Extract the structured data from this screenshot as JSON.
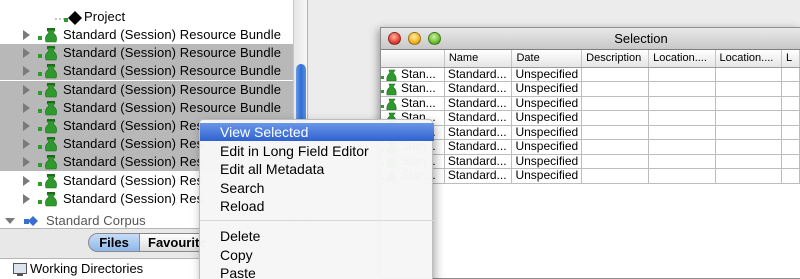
{
  "tree": {
    "project_label": "Project",
    "rows": [
      {
        "label": "Standard (Session) Resource Bundle",
        "selected": false
      },
      {
        "label": "Standard (Session) Resource Bundle",
        "selected": true
      },
      {
        "label": "Standard (Session) Resource Bundle",
        "selected": true
      },
      {
        "label": "Standard (Session) Resource Bundle",
        "selected": true
      },
      {
        "label": "Standard (Session) Resource Bundle",
        "selected": true
      },
      {
        "label": "Standard (Session) Res",
        "selected": true
      },
      {
        "label": "Standard (Session) Res",
        "selected": true
      },
      {
        "label": "Standard (Session) Res",
        "selected": true
      },
      {
        "label": "Standard (Session) Res",
        "selected": false
      },
      {
        "label": "Standard (Session) Res",
        "selected": false
      }
    ],
    "partial_label": "Standard Corpus"
  },
  "tabs": {
    "files": "Files",
    "favourites": "Favourite"
  },
  "working_directories": "Working Directories",
  "selection_window": {
    "title": "Selection",
    "columns": [
      "",
      "Name",
      "Date",
      "Description",
      "Location....",
      "Location....",
      "L"
    ],
    "rows": [
      {
        "type": "Stan...",
        "name": "Standard...",
        "date": "Unspecified"
      },
      {
        "type": "Stan...",
        "name": "Standard...",
        "date": "Unspecified"
      },
      {
        "type": "Stan...",
        "name": "Standard...",
        "date": "Unspecified"
      },
      {
        "type": "Stan...",
        "name": "Standard...",
        "date": "Unspecified"
      },
      {
        "type": "Stan...",
        "name": "Standard...",
        "date": "Unspecified"
      },
      {
        "type": "Stan...",
        "name": "Standard...",
        "date": "Unspecified"
      },
      {
        "type": "Stan...",
        "name": "Standard...",
        "date": "Unspecified"
      },
      {
        "type": "Stan...",
        "name": "Standard...",
        "date": "Unspecified"
      }
    ]
  },
  "context_menu": {
    "group1": [
      "View Selected",
      "Edit in Long Field Editor",
      "Edit all Metadata",
      "Search",
      "Reload"
    ],
    "group2": [
      "Delete",
      "Copy",
      "Paste"
    ]
  },
  "colors": {
    "selection_highlight": "#b8b8b8",
    "menu_active": "#2f62d0",
    "scroll_thumb": "#2f6fd6",
    "bundle_icon": "#2e9a2e"
  }
}
